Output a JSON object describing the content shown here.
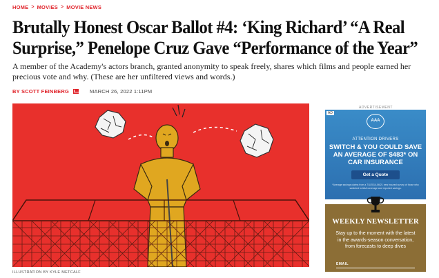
{
  "breadcrumb": {
    "home": "HOME",
    "movies": "MOVIES",
    "current": "MOVIE NEWS",
    "sep": ">"
  },
  "article": {
    "headline": "Brutally Honest Oscar Ballot #4: ‘King Richard’ “A Real Surprise,” Penelope Cruz Gave “Performance of the Year”",
    "dek": "A member of the Academy's actors branch, granted anonymity to speak freely, shares which films and people earned her precious vote and why. (These are her unfiltered views and words.)",
    "author": "BY SCOTT FEINBERG",
    "date": "MARCH 26, 2022 1:11PM",
    "image_credit": "ILLUSTRATION BY KYLE METCALF"
  },
  "ad": {
    "label": "ADVERTISEMENT",
    "tag": "AD",
    "logo": "AAA",
    "drivers": "ATTENTION DRIVERS",
    "promo": "SWITCH & YOU COULD SAVE AN AVERAGE OF $483* ON CAR INSURANCE",
    "cta": "Get a Quote",
    "fine_print": "*Average savings claims from a 7/1/2014-06/21 new insured survey of those who switched to AAA coverage and reported savings."
  },
  "newsletter": {
    "title": "WEEKLY NEWSLETTER",
    "text": "Stay up to the moment with the latest in the awards-season conversation, from forecasts to deep dives",
    "email_label": "EMAIL"
  },
  "colors": {
    "accent": "#e0242b",
    "hero_bg": "#e8302c",
    "gold": "#e0a720",
    "newsletter_bg": "#8c6e36",
    "ad_bg": "#2c6fb0"
  }
}
